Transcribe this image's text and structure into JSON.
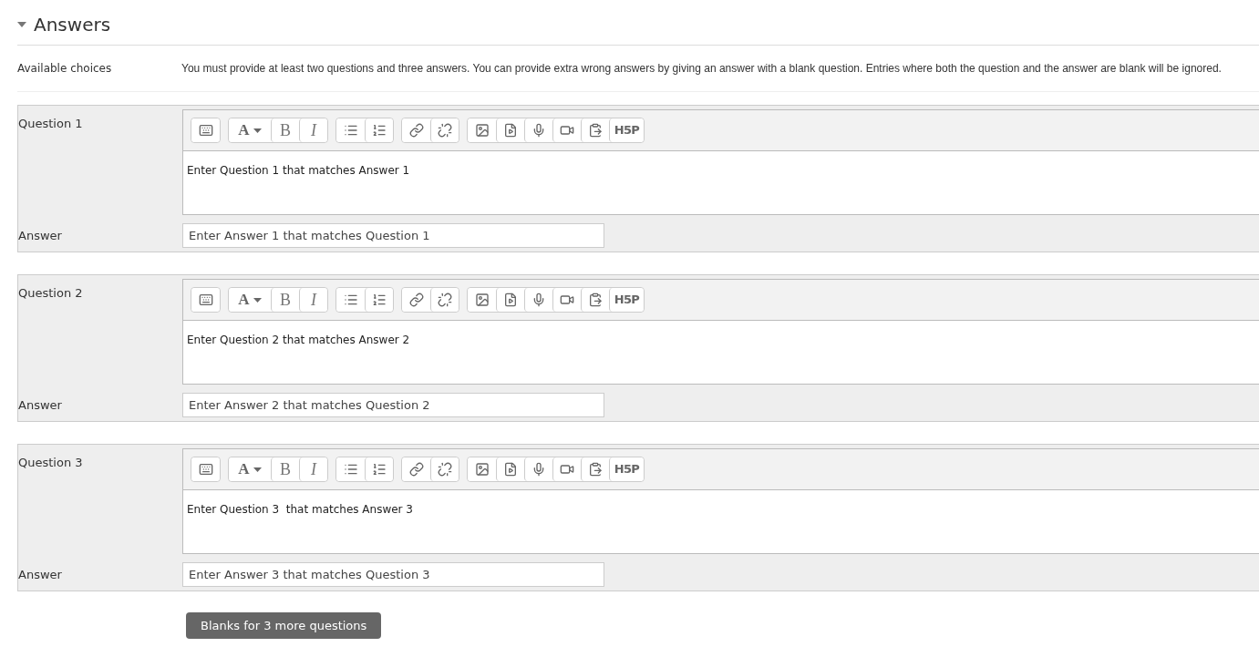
{
  "section": {
    "title": "Answers",
    "expanded": true
  },
  "available_choices": {
    "label": "Available choices",
    "text": "You must provide at least two questions and three answers. You can provide extra wrong answers by giving an answer with a blank question. Entries where both the question and the answer are blank will be ignored."
  },
  "questions": [
    {
      "label": "Question 1",
      "toolbar": [
        [
          {
            "kind": "toggle"
          }
        ],
        [
          {
            "kind": "font",
            "label": "A"
          },
          {
            "kind": "bold",
            "label": "B"
          },
          {
            "kind": "italic",
            "label": "I"
          }
        ],
        [
          {
            "kind": "bullets"
          },
          {
            "kind": "numbers"
          }
        ],
        [
          {
            "kind": "link"
          },
          {
            "kind": "unlink"
          }
        ],
        [
          {
            "kind": "image"
          },
          {
            "kind": "media"
          },
          {
            "kind": "mic"
          },
          {
            "kind": "video"
          },
          {
            "kind": "paste"
          },
          {
            "kind": "h5p",
            "label": "H5P"
          }
        ]
      ],
      "text": "Enter Question 1 that matches Answer 1",
      "answer_label": "Answer",
      "answer": "Enter Answer 1 that matches Question 1"
    },
    {
      "label": "Question 2",
      "toolbar": [
        [
          {
            "kind": "toggle"
          }
        ],
        [
          {
            "kind": "font",
            "label": "A"
          },
          {
            "kind": "bold",
            "label": "B"
          },
          {
            "kind": "italic",
            "label": "I"
          }
        ],
        [
          {
            "kind": "bullets"
          },
          {
            "kind": "numbers"
          }
        ],
        [
          {
            "kind": "link"
          },
          {
            "kind": "unlink"
          }
        ],
        [
          {
            "kind": "image"
          },
          {
            "kind": "media"
          },
          {
            "kind": "mic"
          },
          {
            "kind": "video"
          },
          {
            "kind": "paste"
          },
          {
            "kind": "h5p",
            "label": "H5P"
          }
        ]
      ],
      "text": "Enter Question 2 that matches Answer 2",
      "answer_label": "Answer",
      "answer": "Enter Answer 2 that matches Question 2"
    },
    {
      "label": "Question 3",
      "toolbar": [
        [
          {
            "kind": "toggle"
          }
        ],
        [
          {
            "kind": "font",
            "label": "A"
          },
          {
            "kind": "bold",
            "label": "B"
          },
          {
            "kind": "italic",
            "label": "I"
          }
        ],
        [
          {
            "kind": "bullets"
          },
          {
            "kind": "numbers"
          }
        ],
        [
          {
            "kind": "link"
          },
          {
            "kind": "unlink"
          }
        ],
        [
          {
            "kind": "image"
          },
          {
            "kind": "media"
          },
          {
            "kind": "mic"
          },
          {
            "kind": "video"
          },
          {
            "kind": "paste"
          },
          {
            "kind": "h5p",
            "label": "H5P"
          }
        ]
      ],
      "text": "Enter Question 3  that matches Answer 3",
      "answer_label": "Answer",
      "answer": "Enter Answer 3 that matches Question 3"
    }
  ],
  "more_button": "Blanks for 3 more questions"
}
